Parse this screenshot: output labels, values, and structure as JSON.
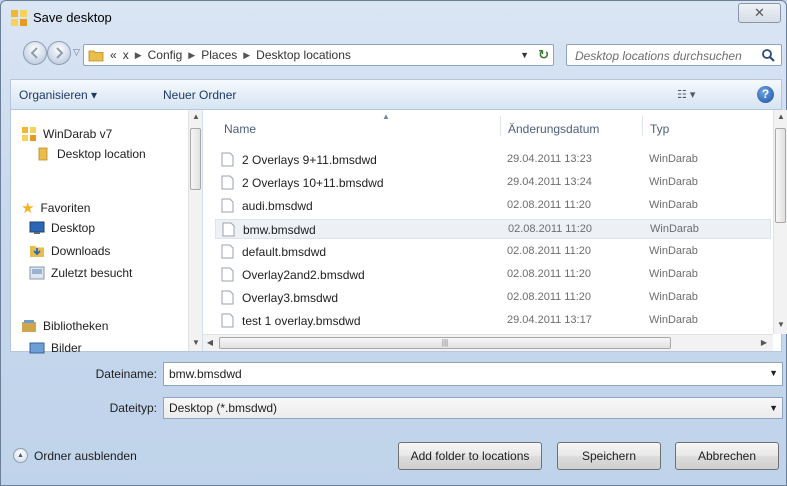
{
  "window": {
    "title": "Save desktop",
    "close_glyph": "✕"
  },
  "address": {
    "overflow": "«",
    "crumbs": [
      "x",
      "Config",
      "Places",
      "Desktop locations"
    ],
    "search_placeholder": "Desktop locations durchsuchen"
  },
  "toolbar": {
    "organize": "Organisieren ▾",
    "new_folder": "Neuer Ordner"
  },
  "nav": {
    "items": [
      {
        "label": "WinDarab v7",
        "icon": "windarab-icon"
      },
      {
        "label": "Desktop location",
        "icon": "folder-icon"
      },
      {
        "label": "Favoriten",
        "icon": "star-icon"
      },
      {
        "label": "Desktop",
        "icon": "desktop-icon"
      },
      {
        "label": "Downloads",
        "icon": "downloads-icon"
      },
      {
        "label": "Zuletzt besucht",
        "icon": "recent-icon"
      },
      {
        "label": "Bibliotheken",
        "icon": "library-icon"
      },
      {
        "label": "Bilder",
        "icon": "pictures-icon"
      }
    ]
  },
  "files": {
    "columns": {
      "name": "Name",
      "date": "Änderungsdatum",
      "type": "Typ"
    },
    "rows": [
      {
        "name": "2 Overlays 9+11.bmsdwd",
        "date": "29.04.2011 13:23",
        "type": "WinDarab"
      },
      {
        "name": "2 Overlays 10+11.bmsdwd",
        "date": "29.04.2011 13:24",
        "type": "WinDarab"
      },
      {
        "name": "audi.bmsdwd",
        "date": "02.08.2011 11:20",
        "type": "WinDarab"
      },
      {
        "name": "bmw.bmsdwd",
        "date": "02.08.2011 11:20",
        "type": "WinDarab"
      },
      {
        "name": "default.bmsdwd",
        "date": "02.08.2011 11:20",
        "type": "WinDarab"
      },
      {
        "name": "Overlay2and2.bmsdwd",
        "date": "02.08.2011 11:20",
        "type": "WinDarab"
      },
      {
        "name": "Overlay3.bmsdwd",
        "date": "02.08.2011 11:20",
        "type": "WinDarab"
      },
      {
        "name": "test 1 overlay.bmsdwd",
        "date": "29.04.2011 13:17",
        "type": "WinDarab"
      }
    ],
    "selected_index": 3
  },
  "form": {
    "filename_label": "Dateiname:",
    "filename_value": "bmw.bmsdwd",
    "filetype_label": "Dateityp:",
    "filetype_value": "Desktop (*.bmsdwd)"
  },
  "footer": {
    "hide_folders": "Ordner ausblenden",
    "add_folder": "Add folder to locations",
    "save": "Speichern",
    "cancel": "Abbrechen"
  }
}
